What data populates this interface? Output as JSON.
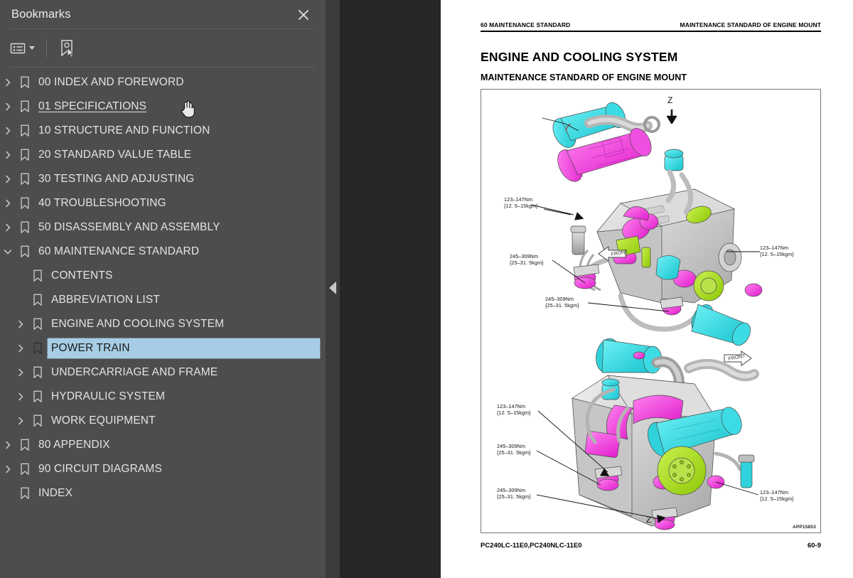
{
  "sidebar": {
    "title": "Bookmarks",
    "close_icon": "close-icon",
    "toolbar": {
      "options_icon": "list-options-icon",
      "options_caret": "chevron-down-icon",
      "find_bookmark_icon": "bookmark-pointer-icon"
    },
    "selected_item": "POWER TRAIN",
    "hovered_item": "01 SPECIFICATIONS",
    "items": [
      {
        "label": "00 INDEX AND FOREWORD",
        "level": 0,
        "twisty": "collapsed",
        "state": "normal"
      },
      {
        "label": "01 SPECIFICATIONS",
        "level": 0,
        "twisty": "collapsed",
        "state": "hovered"
      },
      {
        "label": "10 STRUCTURE AND FUNCTION",
        "level": 0,
        "twisty": "collapsed",
        "state": "normal"
      },
      {
        "label": "20 STANDARD VALUE TABLE",
        "level": 0,
        "twisty": "collapsed",
        "state": "normal"
      },
      {
        "label": "30 TESTING AND ADJUSTING",
        "level": 0,
        "twisty": "collapsed",
        "state": "normal"
      },
      {
        "label": "40 TROUBLESHOOTING",
        "level": 0,
        "twisty": "collapsed",
        "state": "normal"
      },
      {
        "label": "50 DISASSEMBLY AND ASSEMBLY",
        "level": 0,
        "twisty": "collapsed",
        "state": "normal"
      },
      {
        "label": "60 MAINTENANCE STANDARD",
        "level": 0,
        "twisty": "expanded",
        "state": "normal"
      },
      {
        "label": "CONTENTS",
        "level": 1,
        "twisty": "none",
        "state": "normal"
      },
      {
        "label": "ABBREVIATION LIST",
        "level": 1,
        "twisty": "none",
        "state": "normal"
      },
      {
        "label": "ENGINE AND COOLING SYSTEM",
        "level": 1,
        "twisty": "collapsed",
        "state": "normal"
      },
      {
        "label": "POWER TRAIN",
        "level": 1,
        "twisty": "collapsed",
        "state": "selected"
      },
      {
        "label": "UNDERCARRIAGE AND FRAME",
        "level": 1,
        "twisty": "collapsed",
        "state": "normal"
      },
      {
        "label": "HYDRAULIC SYSTEM",
        "level": 1,
        "twisty": "collapsed",
        "state": "normal"
      },
      {
        "label": "WORK EQUIPMENT",
        "level": 1,
        "twisty": "collapsed",
        "state": "normal"
      },
      {
        "label": "80 APPENDIX",
        "level": 0,
        "twisty": "collapsed",
        "state": "normal"
      },
      {
        "label": "90 CIRCUIT DIAGRAMS",
        "level": 0,
        "twisty": "collapsed",
        "state": "normal"
      },
      {
        "label": "INDEX",
        "level": 0,
        "twisty": "none",
        "state": "normal"
      }
    ]
  },
  "splitter": {
    "handle_icon": "collapse-left-icon"
  },
  "document": {
    "header_left": "60 MAINTENANCE STANDARD",
    "header_right": "MAINTENANCE STANDARD OF ENGINE MOUNT",
    "title": "ENGINE AND COOLING SYSTEM",
    "subtitle": "MAINTENANCE STANDARD OF ENGINE MOUNT",
    "figure": {
      "code": "APP15853",
      "section_mark_top": "Z",
      "section_mark_bottom": "Z",
      "front_tag_upper": "FRONT",
      "front_tag_lower": "FRONT",
      "callouts": [
        {
          "id": "u1",
          "line1": "123–147Nm",
          "line2": "{12. 5–15kgm}"
        },
        {
          "id": "u2",
          "line1": "245–309Nm",
          "line2": "{25–31. 5kgm}"
        },
        {
          "id": "u3",
          "line1": "245–309Nm",
          "line2": "{25–31. 5kgm}"
        },
        {
          "id": "u4",
          "line1": "123–147Nm",
          "line2": "{12. 5–15kgm}"
        },
        {
          "id": "l1",
          "line1": "123–147Nm",
          "line2": "{12. 5–15kgm}"
        },
        {
          "id": "l2",
          "line1": "245–309Nm",
          "line2": "{25–31. 5kgm}"
        },
        {
          "id": "l3",
          "line1": "245–309Nm",
          "line2": "{25–31. 5kgm}"
        },
        {
          "id": "l4",
          "line1": "123–147Nm",
          "line2": "{12. 5–15kgm}"
        }
      ]
    },
    "footer_left": "PC240LC-11E0,PC240NLC-11E0",
    "footer_right": "60-9"
  },
  "colors": {
    "sidebar_bg": "#4d4d4d",
    "splitter_bg": "#3c3c3c",
    "viewer_bg": "#272727",
    "selection": "#a6cde5",
    "part_cyan": "#2fd8e0",
    "part_magenta": "#f03bdc",
    "part_green": "#a8e020",
    "part_grey": "#c9c9c9"
  }
}
